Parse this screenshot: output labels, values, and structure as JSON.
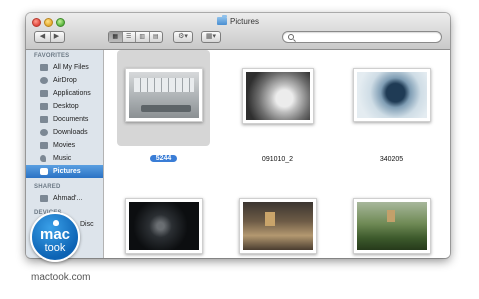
{
  "window": {
    "title": "Pictures"
  },
  "toolbar": {
    "back_symbol": "◀",
    "forward_symbol": "▶",
    "views": [
      "icon-view",
      "list-view",
      "column-view",
      "coverflow-view"
    ],
    "gear_symbol": "⚙▾",
    "arrange_symbol": "▦▾",
    "search_placeholder": ""
  },
  "sidebar": {
    "favorites_header": "FAVORITES",
    "favorites": [
      {
        "label": "All My Files",
        "icon": "all-files-icon"
      },
      {
        "label": "AirDrop",
        "icon": "airdrop-icon"
      },
      {
        "label": "Applications",
        "icon": "applications-icon"
      },
      {
        "label": "Desktop",
        "icon": "desktop-icon"
      },
      {
        "label": "Documents",
        "icon": "documents-icon"
      },
      {
        "label": "Downloads",
        "icon": "downloads-icon"
      },
      {
        "label": "Movies",
        "icon": "movies-icon"
      },
      {
        "label": "Music",
        "icon": "music-icon"
      },
      {
        "label": "Pictures",
        "icon": "pictures-icon",
        "selected": true
      }
    ],
    "shared_header": "SHARED",
    "shared": [
      {
        "label": "Ahmad'...",
        "icon": "computer-icon"
      }
    ],
    "devices_header": "DEVICES",
    "devices": [
      {
        "label": "Disc",
        "icon": "disc-icon"
      }
    ]
  },
  "files": [
    {
      "name": "5244",
      "selected": true
    },
    {
      "name": "091010_2"
    },
    {
      "name": "340205"
    },
    {
      "name": ""
    },
    {
      "name": ""
    },
    {
      "name": ""
    }
  ],
  "branding": {
    "logo_line1": "mac",
    "logo_line2": "took",
    "watermark": "mactook.com"
  },
  "colors": {
    "selection": "#3a7dd6",
    "sidebar_bg": "#dde4eb"
  }
}
